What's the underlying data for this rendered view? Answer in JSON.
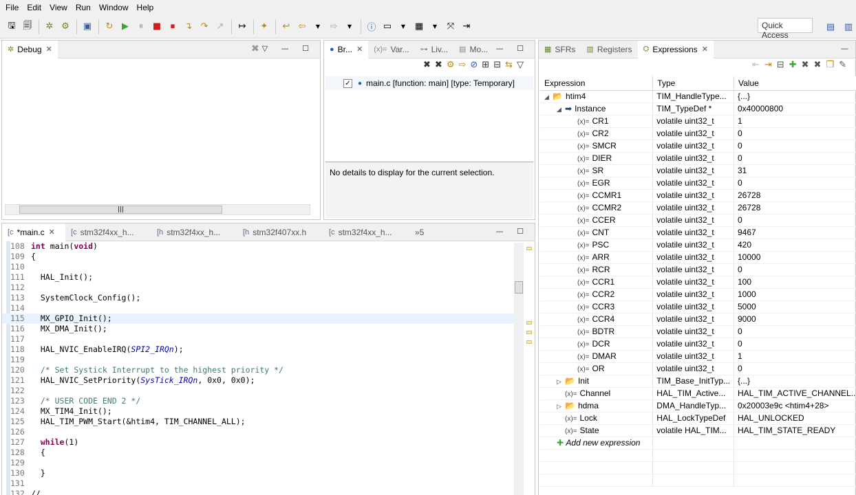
{
  "menu": [
    "File",
    "Edit",
    "View",
    "Run",
    "Window",
    "Help"
  ],
  "toolbar": {
    "quick_access": "Quick Access",
    "icons": [
      "save-icon",
      "save-all-icon",
      "debug-icon",
      "debug-config-icon",
      "console-icon",
      "resume-icon",
      "resume-all-icon",
      "suspend-icon",
      "terminate-icon",
      "terminate-relaunch-icon",
      "step-into-icon",
      "step-over-icon",
      "step-return-icon",
      "instruction-step-icon",
      "open-perspective-icon",
      "back-icon",
      "forward-icon",
      "info-icon",
      "window-icon",
      "table-icon",
      "fullscreen-icon",
      "exit-icon"
    ]
  },
  "debug_view": {
    "tab": "Debug"
  },
  "breakpoints_view": {
    "tabs": [
      "Br...",
      "Var...",
      "Liv...",
      "Mo..."
    ],
    "entry": "main.c [function: main] [type: Temporary]",
    "details": "No details to display for the current selection."
  },
  "editor": {
    "tabs": [
      "*main.c",
      "stm32f4xx_h...",
      "stm32f4xx_h...",
      "stm32f407xx.h",
      "stm32f4xx_h..."
    ],
    "overflow": "»5",
    "lines": [
      {
        "n": "108",
        "t": "int main(void)"
      },
      {
        "n": "109",
        "t": "{"
      },
      {
        "n": "110",
        "t": ""
      },
      {
        "n": "111",
        "t": "  HAL_Init();"
      },
      {
        "n": "112",
        "t": ""
      },
      {
        "n": "113",
        "t": "  SystemClock_Config();"
      },
      {
        "n": "114",
        "t": ""
      },
      {
        "n": "115",
        "t": "  MX_GPIO_Init();"
      },
      {
        "n": "116",
        "t": "  MX_DMA_Init();"
      },
      {
        "n": "117",
        "t": ""
      },
      {
        "n": "118",
        "t": "  HAL_NVIC_EnableIRQ(SPI2_IRQn);"
      },
      {
        "n": "119",
        "t": ""
      },
      {
        "n": "120",
        "t": "  /* Set Systick Interrupt to the highest priority */"
      },
      {
        "n": "121",
        "t": "  HAL_NVIC_SetPriority(SysTick_IRQn, 0x0, 0x0);"
      },
      {
        "n": "122",
        "t": ""
      },
      {
        "n": "123",
        "t": "  /* USER CODE END 2 */"
      },
      {
        "n": "124",
        "t": "  MX_TIM4_Init();"
      },
      {
        "n": "125",
        "t": "  HAL_TIM_PWM_Start(&htim4, TIM_CHANNEL_ALL);"
      },
      {
        "n": "126",
        "t": ""
      },
      {
        "n": "127",
        "t": "  while(1)"
      },
      {
        "n": "128",
        "t": "  {"
      },
      {
        "n": "129",
        "t": ""
      },
      {
        "n": "130",
        "t": "  }"
      },
      {
        "n": "131",
        "t": ""
      },
      {
        "n": "132",
        "t": "//"
      }
    ]
  },
  "expressions_view": {
    "tabs": [
      "SFRs",
      "Registers",
      "Expressions"
    ],
    "headers": [
      "Expression",
      "Type",
      "Value"
    ],
    "rows": [
      {
        "name": "htim4",
        "type": "TIM_HandleType...",
        "value": "{...}",
        "icon": "struct"
      },
      {
        "name": "Instance",
        "type": "TIM_TypeDef *",
        "value": "0x40000800",
        "icon": "pointer"
      },
      {
        "name": "CR1",
        "type": "volatile uint32_t",
        "value": "1",
        "icon": "var"
      },
      {
        "name": "CR2",
        "type": "volatile uint32_t",
        "value": "0",
        "icon": "var"
      },
      {
        "name": "SMCR",
        "type": "volatile uint32_t",
        "value": "0",
        "icon": "var"
      },
      {
        "name": "DIER",
        "type": "volatile uint32_t",
        "value": "0",
        "icon": "var"
      },
      {
        "name": "SR",
        "type": "volatile uint32_t",
        "value": "31",
        "icon": "var"
      },
      {
        "name": "EGR",
        "type": "volatile uint32_t",
        "value": "0",
        "icon": "var"
      },
      {
        "name": "CCMR1",
        "type": "volatile uint32_t",
        "value": "26728",
        "icon": "var"
      },
      {
        "name": "CCMR2",
        "type": "volatile uint32_t",
        "value": "26728",
        "icon": "var"
      },
      {
        "name": "CCER",
        "type": "volatile uint32_t",
        "value": "0",
        "icon": "var"
      },
      {
        "name": "CNT",
        "type": "volatile uint32_t",
        "value": "9467",
        "icon": "var"
      },
      {
        "name": "PSC",
        "type": "volatile uint32_t",
        "value": "420",
        "icon": "var"
      },
      {
        "name": "ARR",
        "type": "volatile uint32_t",
        "value": "10000",
        "icon": "var"
      },
      {
        "name": "RCR",
        "type": "volatile uint32_t",
        "value": "0",
        "icon": "var"
      },
      {
        "name": "CCR1",
        "type": "volatile uint32_t",
        "value": "100",
        "icon": "var"
      },
      {
        "name": "CCR2",
        "type": "volatile uint32_t",
        "value": "1000",
        "icon": "var"
      },
      {
        "name": "CCR3",
        "type": "volatile uint32_t",
        "value": "5000",
        "icon": "var"
      },
      {
        "name": "CCR4",
        "type": "volatile uint32_t",
        "value": "9000",
        "icon": "var"
      },
      {
        "name": "BDTR",
        "type": "volatile uint32_t",
        "value": "0",
        "icon": "var"
      },
      {
        "name": "DCR",
        "type": "volatile uint32_t",
        "value": "0",
        "icon": "var"
      },
      {
        "name": "DMAR",
        "type": "volatile uint32_t",
        "value": "1",
        "icon": "var"
      },
      {
        "name": "OR",
        "type": "volatile uint32_t",
        "value": "0",
        "icon": "var"
      },
      {
        "name": "Init",
        "type": "TIM_Base_InitTyp...",
        "value": "{...}",
        "icon": "struct"
      },
      {
        "name": "Channel",
        "type": "HAL_TIM_Active...",
        "value": "HAL_TIM_ACTIVE_CHANNEL...",
        "icon": "var"
      },
      {
        "name": "hdma",
        "type": "DMA_HandleTyp...",
        "value": "0x20003e9c <htim4+28>",
        "icon": "struct"
      },
      {
        "name": "Lock",
        "type": "HAL_LockTypeDef",
        "value": "HAL_UNLOCKED",
        "icon": "var"
      },
      {
        "name": "State",
        "type": "volatile HAL_TIM...",
        "value": "HAL_TIM_STATE_READY",
        "icon": "var"
      }
    ],
    "add_label": "Add new expression"
  }
}
